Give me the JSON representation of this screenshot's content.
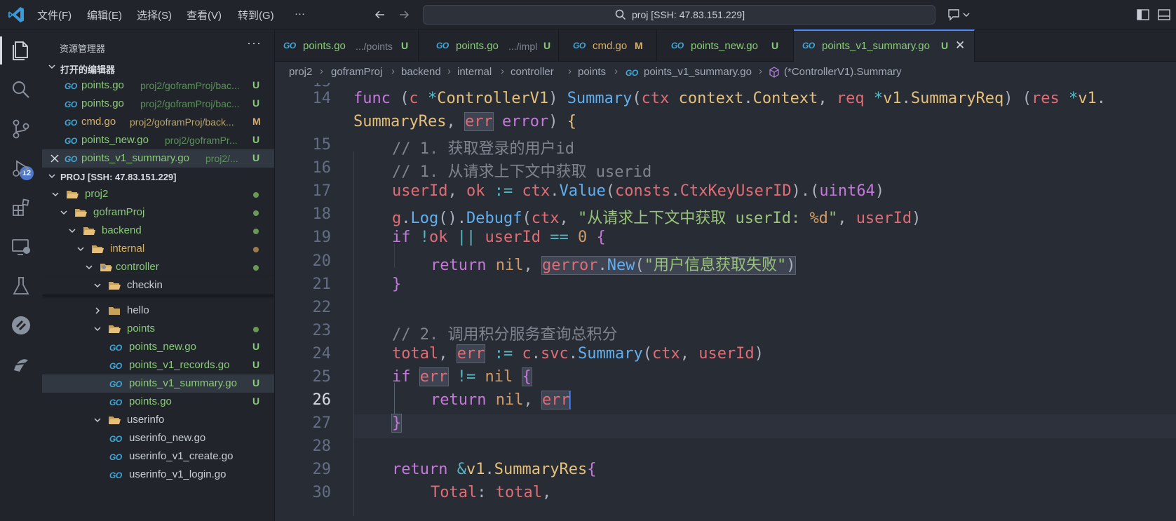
{
  "titlebar": {
    "menu": [
      "文件(F)",
      "编辑(E)",
      "选择(S)",
      "查看(V)",
      "转到(G)",
      "···"
    ],
    "search": "proj [SSH: 47.83.151.229]"
  },
  "activity": {
    "scm_badge": "12"
  },
  "sidebar": {
    "title": "资源管理器",
    "open_editors_header": "打开的编辑器",
    "open_editors": [
      {
        "name": "points.go",
        "path": "proj2/goframProj/bac...",
        "status": "U"
      },
      {
        "name": "points.go",
        "path": "proj2/goframProj/bac...",
        "status": "U"
      },
      {
        "name": "cmd.go",
        "path": "proj2/goframProj/back...",
        "status": "M"
      },
      {
        "name": "points_new.go",
        "path": "proj2/goframPr...",
        "status": "U"
      },
      {
        "name": "points_v1_summary.go",
        "path": "proj2/...",
        "status": "U"
      }
    ],
    "folder_header": "PROJ [SSH: 47.83.151.229]",
    "tree": [
      {
        "name": "proj2"
      },
      {
        "name": "goframProj"
      },
      {
        "name": "backend"
      },
      {
        "name": "internal"
      },
      {
        "name": "controller"
      },
      {
        "name": "checkin"
      },
      {
        "name": "hello"
      },
      {
        "name": "points"
      },
      {
        "name": "points_new.go",
        "status": "U"
      },
      {
        "name": "points_v1_records.go",
        "status": "U"
      },
      {
        "name": "points_v1_summary.go",
        "status": "U"
      },
      {
        "name": "points.go",
        "status": "U"
      },
      {
        "name": "userinfo"
      },
      {
        "name": "userinfo_new.go"
      },
      {
        "name": "userinfo_v1_create.go"
      },
      {
        "name": "userinfo_v1_login.go"
      }
    ]
  },
  "tabs": [
    {
      "name": "points.go",
      "path": ".../points",
      "status": "U"
    },
    {
      "name": "points.go",
      "path": ".../impl",
      "status": "U"
    },
    {
      "name": "cmd.go",
      "path": "",
      "status": "M"
    },
    {
      "name": "points_new.go",
      "path": "",
      "status": "U"
    },
    {
      "name": "points_v1_summary.go",
      "path": "",
      "status": "U",
      "close": "✕"
    }
  ],
  "breadcrumb": [
    "proj2",
    "goframProj",
    "backend",
    "internal",
    "controller",
    "points",
    "points_v1_summary.go",
    "(*ControllerV1).Summary"
  ],
  "editor": {
    "line_numbers": [
      "15",
      "14",
      "15",
      "16",
      "17",
      "18",
      "19",
      "20",
      "21",
      "22",
      "23",
      "24",
      "25",
      "26",
      "27",
      "28",
      "29",
      "30"
    ],
    "current_line": "26"
  },
  "colors": {
    "accent": "#528bff",
    "untracked": "#89ca78",
    "modified": "#d5b06b"
  }
}
